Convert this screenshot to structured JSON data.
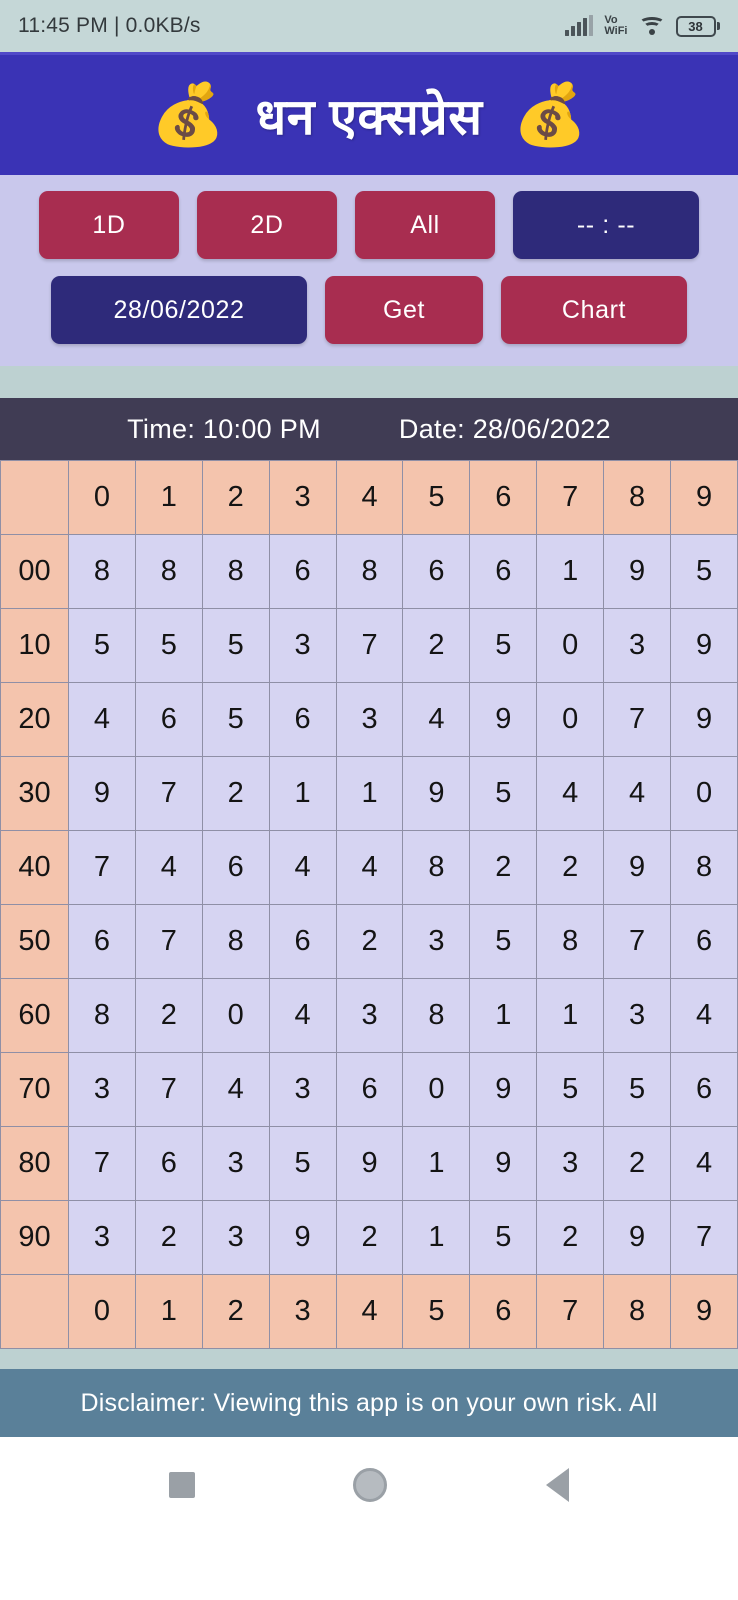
{
  "status_bar": {
    "time": "11:45 PM | 0.0KB/s",
    "network_label": "Vo\nWiFi",
    "vo_line1": "Vo",
    "vo_line2": "WiFi",
    "battery_level": "38",
    "signal_icon": "signal-bars-icon",
    "wifi_icon": "wifi-icon"
  },
  "header": {
    "title": "धन एक्सप्रेस",
    "left_emoji": "💰",
    "right_emoji": "💰",
    "bg_color": "#3A33B5"
  },
  "controls": {
    "row1": [
      {
        "label": "1D",
        "style": "crimson",
        "name": "btn-1d"
      },
      {
        "label": "2D",
        "style": "crimson",
        "name": "btn-2d"
      },
      {
        "label": "All",
        "style": "crimson",
        "name": "btn-all"
      },
      {
        "label": "-- : --",
        "style": "navy",
        "name": "btn-time-picker"
      }
    ],
    "row2": [
      {
        "label": "28/06/2022",
        "style": "navy",
        "name": "btn-date-picker"
      },
      {
        "label": "Get",
        "style": "crimson",
        "name": "btn-get"
      },
      {
        "label": "Chart",
        "style": "crimson",
        "name": "btn-chart"
      }
    ],
    "accent_crimson": "#A82D50",
    "accent_navy": "#2E2A7A",
    "panel_bg": "#C9C8EC"
  },
  "result_header": {
    "time_label": "Time: 10:00 PM",
    "date_label": "Date: 28/06/2022",
    "bg_color": "#403C54"
  },
  "chart_data": {
    "type": "table",
    "title": "धन एक्सप्रेस Jodi Chart",
    "column_headers": [
      "0",
      "1",
      "2",
      "3",
      "4",
      "5",
      "6",
      "7",
      "8",
      "9"
    ],
    "footer_headers": [
      "0",
      "1",
      "2",
      "3",
      "4",
      "5",
      "6",
      "7",
      "8",
      "9"
    ],
    "corner_label": "",
    "row_labels": [
      "00",
      "10",
      "20",
      "30",
      "40",
      "50",
      "60",
      "70",
      "80",
      "90"
    ],
    "rows": [
      {
        "label": "00",
        "values": [
          "8",
          "8",
          "8",
          "6",
          "8",
          "6",
          "6",
          "1",
          "9",
          "5"
        ]
      },
      {
        "label": "10",
        "values": [
          "5",
          "5",
          "5",
          "3",
          "7",
          "2",
          "5",
          "0",
          "3",
          "9"
        ]
      },
      {
        "label": "20",
        "values": [
          "4",
          "6",
          "5",
          "6",
          "3",
          "4",
          "9",
          "0",
          "7",
          "9"
        ]
      },
      {
        "label": "30",
        "values": [
          "9",
          "7",
          "2",
          "1",
          "1",
          "9",
          "5",
          "4",
          "4",
          "0"
        ]
      },
      {
        "label": "40",
        "values": [
          "7",
          "4",
          "6",
          "4",
          "4",
          "8",
          "2",
          "2",
          "9",
          "8"
        ]
      },
      {
        "label": "50",
        "values": [
          "6",
          "7",
          "8",
          "6",
          "2",
          "3",
          "5",
          "8",
          "7",
          "6"
        ]
      },
      {
        "label": "60",
        "values": [
          "8",
          "2",
          "0",
          "4",
          "3",
          "8",
          "1",
          "1",
          "3",
          "4"
        ]
      },
      {
        "label": "70",
        "values": [
          "3",
          "7",
          "4",
          "3",
          "6",
          "0",
          "9",
          "5",
          "5",
          "6"
        ]
      },
      {
        "label": "80",
        "values": [
          "7",
          "6",
          "3",
          "5",
          "9",
          "1",
          "9",
          "3",
          "2",
          "4"
        ]
      },
      {
        "label": "90",
        "values": [
          "3",
          "2",
          "3",
          "9",
          "2",
          "1",
          "5",
          "2",
          "9",
          "7"
        ]
      }
    ],
    "header_cell_color": "#F4C4AD",
    "data_cell_color": "#D6D4F2",
    "grid_color": "#8F8FA6"
  },
  "disclaimer": {
    "text": "Disclaimer: Viewing this app is on your own risk. All",
    "bg_color": "#5A8099"
  },
  "navbar": {
    "recents_icon": "square-recents-icon",
    "home_icon": "circle-home-icon",
    "back_icon": "triangle-back-icon"
  }
}
